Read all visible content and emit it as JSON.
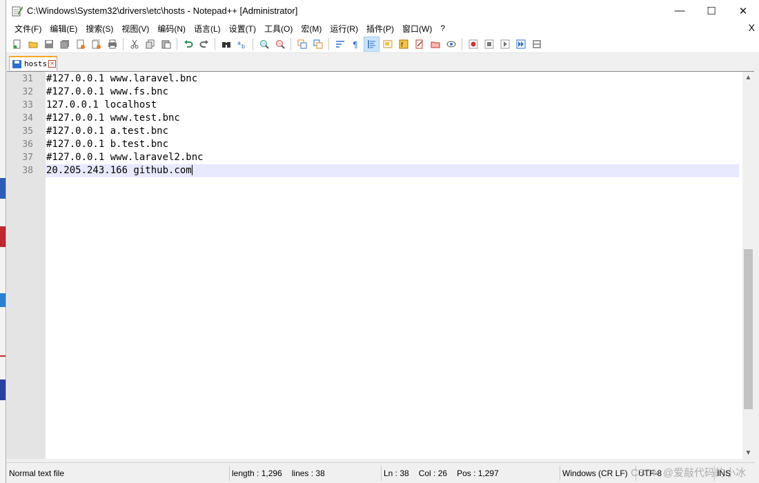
{
  "window": {
    "title": "C:\\Windows\\System32\\drivers\\etc\\hosts - Notepad++ [Administrator]",
    "controls": {
      "minimize": "—",
      "maximize": "☐",
      "close": "✕"
    }
  },
  "menu": {
    "items": [
      "文件(F)",
      "编辑(E)",
      "搜索(S)",
      "视图(V)",
      "编码(N)",
      "语言(L)",
      "设置(T)",
      "工具(O)",
      "宏(M)",
      "运行(R)",
      "插件(P)",
      "窗口(W)",
      "?"
    ],
    "close_label": "X"
  },
  "toolbar": {
    "icons": [
      "new-file-icon",
      "open-file-icon",
      "save-icon",
      "save-all-icon",
      "close-icon",
      "close-all-icon",
      "print-icon",
      "cut-icon",
      "copy-icon",
      "paste-icon",
      "undo-icon",
      "redo-icon",
      "find-icon",
      "replace-icon",
      "zoom-in-icon",
      "zoom-out-icon",
      "sync-vertical-icon",
      "sync-horizontal-icon",
      "word-wrap-icon",
      "show-all-chars-icon",
      "indent-guide-icon",
      "document-map-icon",
      "function-list-icon",
      "folder-workspace-icon",
      "monitoring-icon",
      "record-macro-icon",
      "stop-macro-icon",
      "play-macro-icon",
      "run-macro-multiple-icon",
      "save-macro-icon"
    ],
    "active_icon": "indent-guide-icon"
  },
  "tabs": [
    {
      "label": "hosts",
      "close": "×"
    }
  ],
  "editor": {
    "lines": [
      {
        "number": "31",
        "text": "#127.0.0.1 www.laravel.bnc"
      },
      {
        "number": "32",
        "text": "#127.0.0.1 www.fs.bnc"
      },
      {
        "number": "33",
        "text": "127.0.0.1 localhost"
      },
      {
        "number": "34",
        "text": "#127.0.0.1 www.test.bnc"
      },
      {
        "number": "35",
        "text": "#127.0.0.1 a.test.bnc"
      },
      {
        "number": "36",
        "text": "#127.0.0.1 b.test.bnc"
      },
      {
        "number": "37",
        "text": "#127.0.0.1 www.laravel2.bnc"
      },
      {
        "number": "38",
        "text": "20.205.243.166 github.com"
      }
    ],
    "current_line": "38",
    "scroll": {
      "up": "▲",
      "down": "▼"
    }
  },
  "status": {
    "file_type": "Normal text file",
    "length": "length : 1,296",
    "lines": "lines : 38",
    "ln": "Ln : 38",
    "col": "Col : 26",
    "pos": "Pos : 1,297",
    "eol": "Windows (CR LF)",
    "encoding": "UTF-8",
    "mode": "INS"
  },
  "watermark": "CSDN @爱敲代码的小冰"
}
